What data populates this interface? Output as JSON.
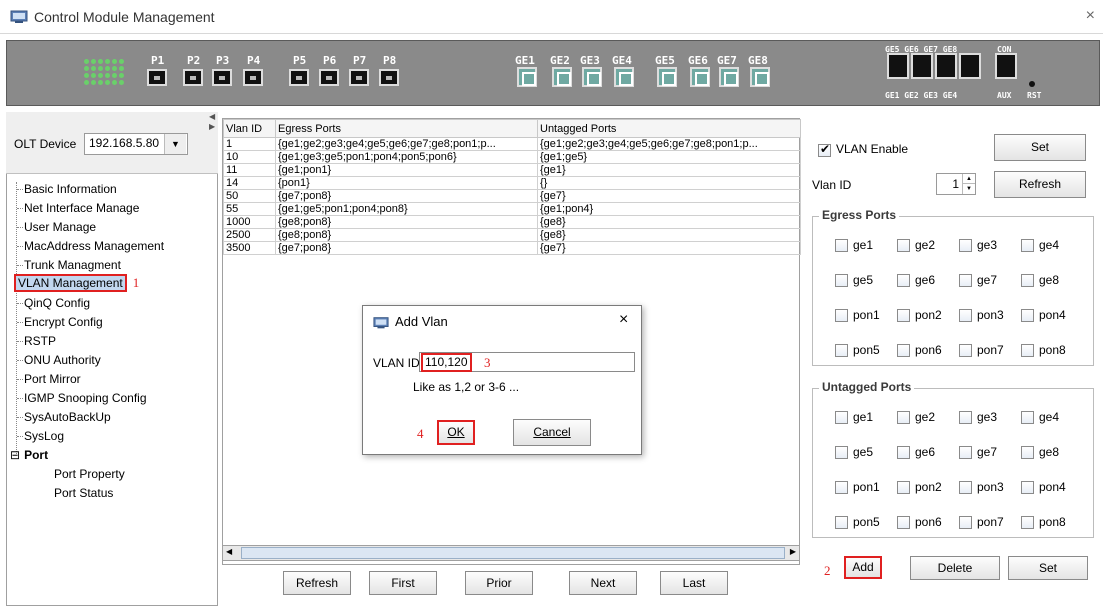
{
  "window": {
    "title": "Control Module Management",
    "close_glyph": "×"
  },
  "device": {
    "ports": [
      "P1",
      "P2",
      "P3",
      "P4",
      "P5",
      "P6",
      "P7",
      "P8"
    ],
    "ge_ports": [
      "GE1",
      "GE2",
      "GE3",
      "GE4",
      "GE5",
      "GE6",
      "GE7",
      "GE8"
    ],
    "combo_top": "GE5 GE6 GE7 GE8",
    "combo_bottom": "GE1 GE2 GE3 GE4",
    "con": "CON",
    "aux": "AUX",
    "rst": "RST"
  },
  "olt": {
    "label": "OLT Device",
    "value": "192.168.5.80"
  },
  "nav": {
    "items": [
      {
        "label": "Basic Information"
      },
      {
        "label": "Net Interface Manage"
      },
      {
        "label": "User Manage"
      },
      {
        "label": "MacAddress Management"
      },
      {
        "label": "Trunk Managment"
      },
      {
        "label": "VLAN Management",
        "marker": "1"
      },
      {
        "label": "QinQ Config"
      },
      {
        "label": "Encrypt Config"
      },
      {
        "label": "RSTP"
      },
      {
        "label": "ONU Authority"
      },
      {
        "label": "Port Mirror"
      },
      {
        "label": "IGMP Snooping Config"
      },
      {
        "label": "SysAutoBackUp"
      },
      {
        "label": "SysLog"
      }
    ],
    "port_group": {
      "label": "Port",
      "children": [
        "Port Property",
        "Port Status"
      ]
    }
  },
  "table": {
    "headers": [
      "Vlan ID",
      "Egress Ports",
      "Untagged Ports"
    ],
    "rows": [
      [
        "1",
        "{ge1;ge2;ge3;ge4;ge5;ge6;ge7;ge8;pon1;p...",
        "{ge1;ge2;ge3;ge4;ge5;ge6;ge7;ge8;pon1;p..."
      ],
      [
        "10",
        "{ge1;ge3;ge5;pon1;pon4;pon5;pon6}",
        "{ge1;ge5}"
      ],
      [
        "11",
        "{ge1;pon1}",
        "{ge1}"
      ],
      [
        "14",
        "{pon1}",
        "{}"
      ],
      [
        "50",
        "{ge7;pon8}",
        "{ge7}"
      ],
      [
        "55",
        "{ge1;ge5;pon1;pon4;pon8}",
        "{ge1;pon4}"
      ],
      [
        "1000",
        "{ge8;pon8}",
        "{ge8}"
      ],
      [
        "2500",
        "{ge8;pon8}",
        "{ge8}"
      ],
      [
        "3500",
        "{ge7;pon8}",
        "{ge7}"
      ]
    ]
  },
  "pager": {
    "refresh": "Refresh",
    "first": "First",
    "prior": "Prior",
    "next": "Next",
    "last": "Last"
  },
  "dialog": {
    "title": "Add Vlan",
    "close": "×",
    "field_label": "VLAN ID",
    "field_value": "110,120",
    "field_marker": "3",
    "hint": "Like as 1,2 or 3-6 ...",
    "ok": "OK",
    "ok_marker": "4",
    "cancel": "Cancel"
  },
  "right": {
    "vlan_enable": "VLAN Enable",
    "set_top": "Set",
    "vlan_id_label": "Vlan ID",
    "vlan_id_value": "1",
    "refresh": "Refresh",
    "egress_title": "Egress Ports",
    "untagged_title": "Untagged Ports",
    "ports": [
      "ge1",
      "ge2",
      "ge3",
      "ge4",
      "ge5",
      "ge6",
      "ge7",
      "ge8",
      "pon1",
      "pon2",
      "pon3",
      "pon4",
      "pon5",
      "pon6",
      "pon7",
      "pon8"
    ],
    "add": "Add",
    "add_marker": "2",
    "delete": "Delete",
    "set_bottom": "Set"
  }
}
